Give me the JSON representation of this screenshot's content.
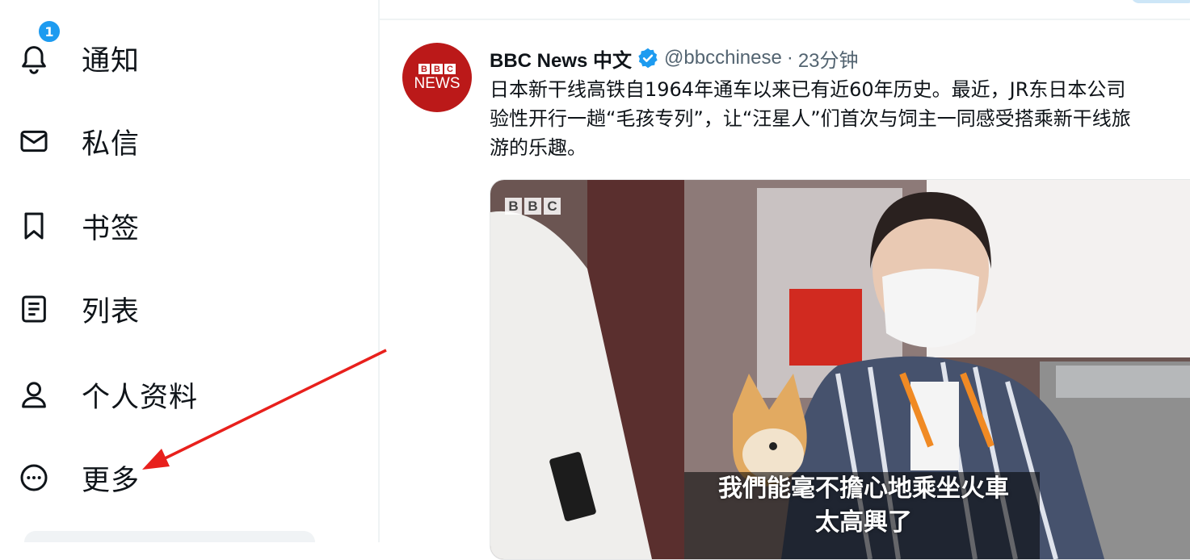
{
  "sidebar": {
    "items": [
      {
        "label": "通知",
        "icon": "bell-icon",
        "badge": "1"
      },
      {
        "label": "私信",
        "icon": "envelope-icon"
      },
      {
        "label": "书签",
        "icon": "bookmark-icon"
      },
      {
        "label": "列表",
        "icon": "list-icon"
      },
      {
        "label": "个人资料",
        "icon": "person-icon"
      },
      {
        "label": "更多",
        "icon": "more-circle-icon"
      }
    ]
  },
  "tweet": {
    "author_name": "BBC News 中文",
    "handle": "@bbcchinese",
    "separator": "·",
    "time": "23分钟",
    "text": "日本新干线高铁自1964年通车以来已有近60年历史。最近，JR东日本公司\n验性开行一趟“毛孩专列”，让“汪星人”们首次与饲主一同感受搭乘新干线旅\n游的乐趣。",
    "avatar": {
      "top": "BBC",
      "bottom": "NEWS",
      "color": "#bb1919"
    },
    "media": {
      "watermark": [
        "B",
        "B",
        "C"
      ],
      "subtitle_line1": "我們能毫不擔心地乘坐火車",
      "subtitle_line2": "太高興了"
    }
  },
  "colors": {
    "accent": "#1d9bf0",
    "annotation_arrow": "#e8201c",
    "bbc_red": "#bb1919"
  }
}
